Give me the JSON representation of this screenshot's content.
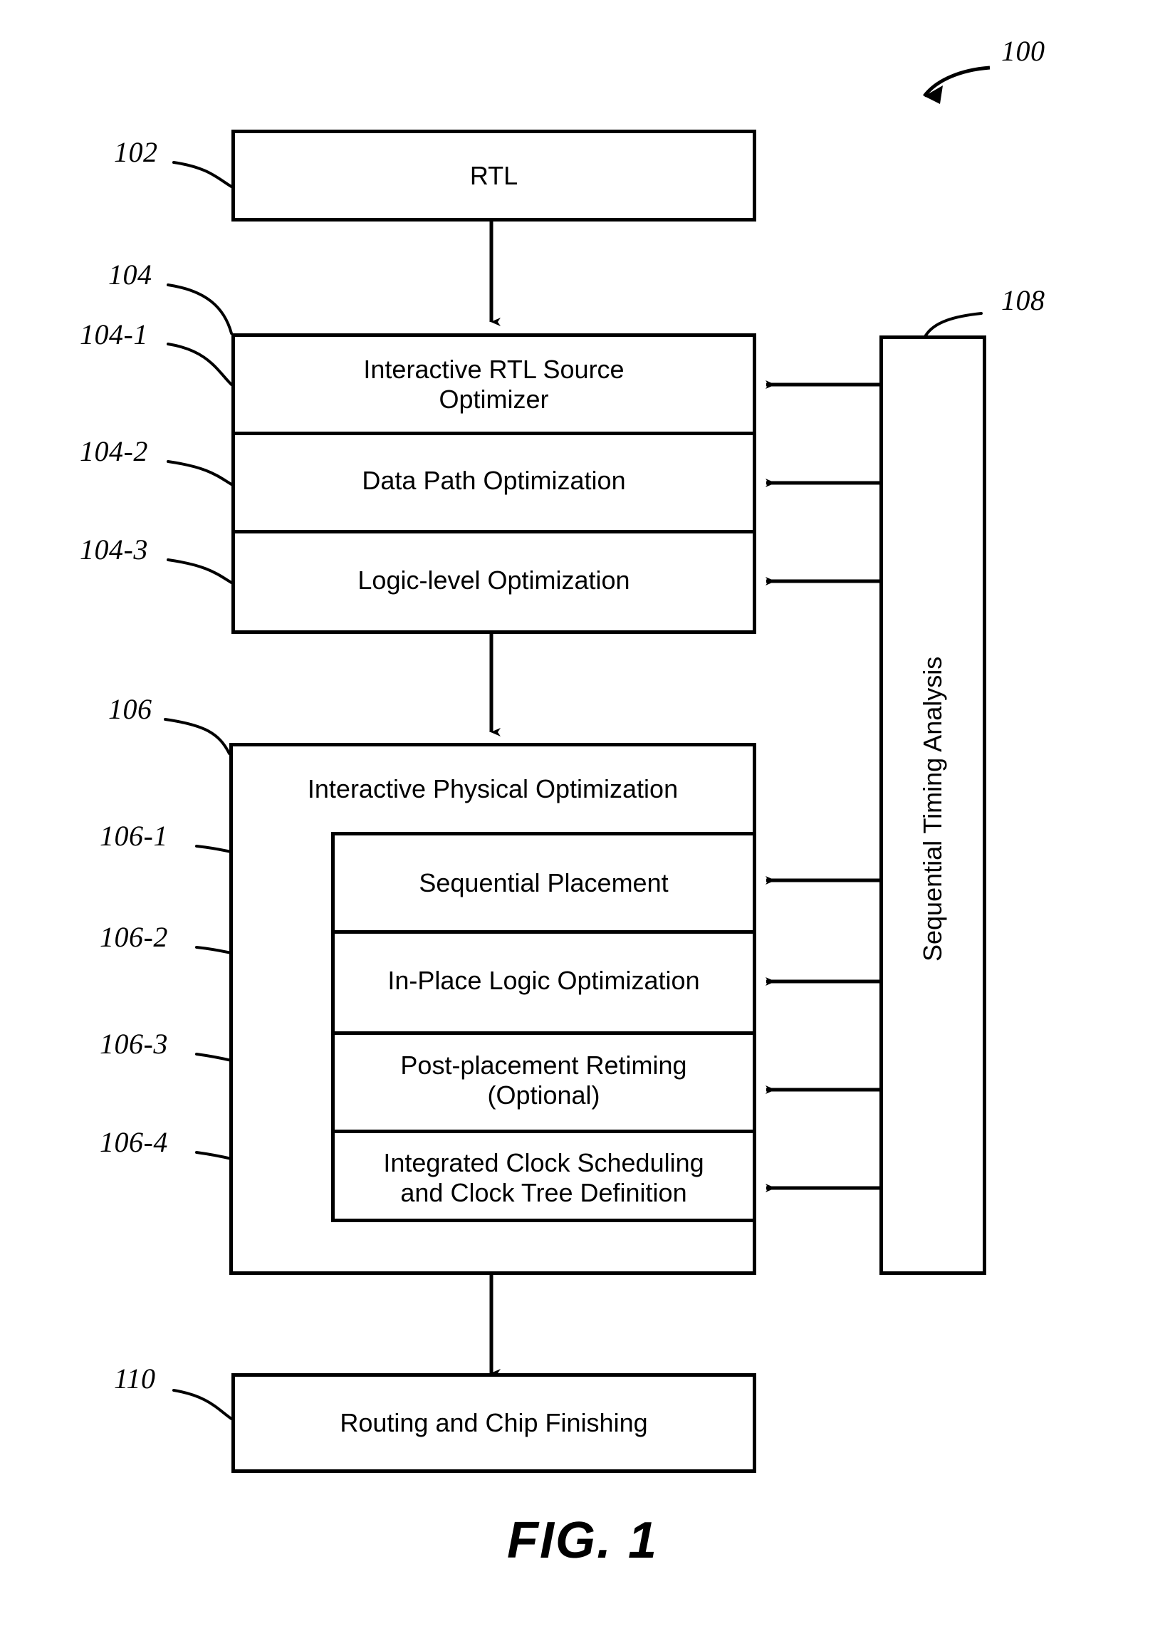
{
  "figure": {
    "caption": "FIG. 1",
    "overall_ref": "100"
  },
  "blocks": [
    {
      "ref": "102",
      "label": "RTL",
      "name": "rtl-block"
    },
    {
      "ref": "104",
      "label": "",
      "name": "optimization-group-block",
      "children": [
        {
          "ref": "104-1",
          "label": "Interactive RTL Source\nOptimizer",
          "name": "interactive-rtl-source-optimizer-block"
        },
        {
          "ref": "104-2",
          "label": "Data Path Optimization",
          "name": "data-path-optimization-block"
        },
        {
          "ref": "104-3",
          "label": "Logic-level Optimization",
          "name": "logic-level-optimization-block"
        }
      ]
    },
    {
      "ref": "106",
      "label": "Interactive Physical Optimization",
      "name": "interactive-physical-optimization-block",
      "children": [
        {
          "ref": "106-1",
          "label": "Sequential Placement",
          "name": "sequential-placement-block"
        },
        {
          "ref": "106-2",
          "label": "In-Place Logic Optimization",
          "name": "in-place-logic-optimization-block"
        },
        {
          "ref": "106-3",
          "label": "Post-placement Retiming\n(Optional)",
          "name": "post-placement-retiming-block"
        },
        {
          "ref": "106-4",
          "label": "Integrated Clock Scheduling\nand Clock Tree Definition",
          "name": "integrated-clock-scheduling-block"
        }
      ]
    },
    {
      "ref": "108",
      "label": "Sequential Timing Analysis",
      "name": "sequential-timing-analysis-block"
    },
    {
      "ref": "110",
      "label": "Routing and Chip Finishing",
      "name": "routing-and-chip-finishing-block"
    }
  ],
  "refs": {
    "r100": "100",
    "r102": "102",
    "r104": "104",
    "r104_1": "104-1",
    "r104_2": "104-2",
    "r104_3": "104-3",
    "r106": "106",
    "r106_1": "106-1",
    "r106_2": "106-2",
    "r106_3": "106-3",
    "r106_4": "106-4",
    "r108": "108",
    "r110": "110"
  },
  "labels": {
    "rtl": "RTL",
    "interactive_rtl_source_optimizer": "Interactive RTL Source\nOptimizer",
    "data_path_optimization": "Data Path Optimization",
    "logic_level_optimization": "Logic-level Optimization",
    "interactive_physical_optimization": "Interactive Physical Optimization",
    "sequential_placement": "Sequential Placement",
    "in_place_logic_optimization": "In-Place Logic Optimization",
    "post_placement_retiming": "Post-placement Retiming\n(Optional)",
    "integrated_clock_scheduling": "Integrated Clock Scheduling\nand Clock Tree Definition",
    "sequential_timing_analysis": "Sequential Timing Analysis",
    "routing_and_chip_finishing": "Routing and Chip Finishing"
  },
  "colors": {
    "ink": "#000000",
    "paper": "#ffffff"
  }
}
